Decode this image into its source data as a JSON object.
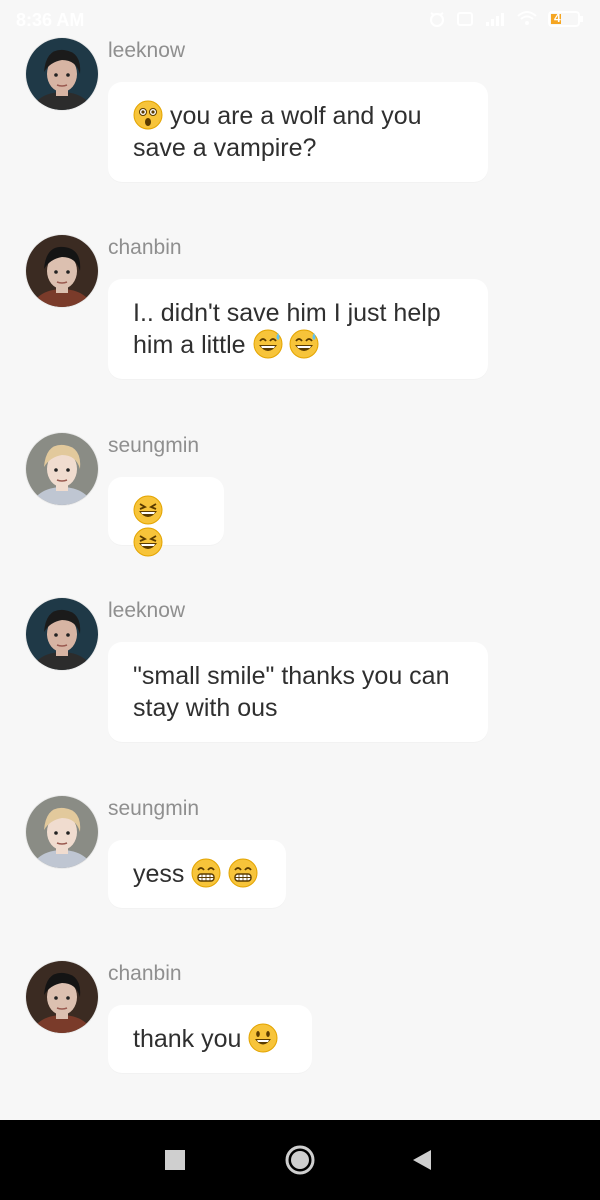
{
  "status_bar": {
    "time": "8:36 AM",
    "battery": "4"
  },
  "messages": [
    {
      "sender": "leeknow",
      "avatar": "leeknow-avatar",
      "emoji_before": [
        "astonished-face"
      ],
      "text": "you are a wolf and you save a vampire?",
      "emoji_after": []
    },
    {
      "sender": "chanbin",
      "avatar": "chanbin-avatar",
      "emoji_before": [],
      "text": "I.. didn't save him I just help him a little",
      "emoji_after": [
        "grinning-sweat-face",
        "grinning-sweat-face"
      ]
    },
    {
      "sender": "seungmin",
      "avatar": "seungmin-avatar",
      "emoji_before": [],
      "text": "",
      "emoji_after": [
        "grinning-squinting-face",
        "grinning-squinting-face"
      ]
    },
    {
      "sender": "leeknow",
      "avatar": "leeknow-avatar",
      "emoji_before": [],
      "text": "\"small smile\" thanks you can stay with ous",
      "emoji_after": []
    },
    {
      "sender": "seungmin",
      "avatar": "seungmin-avatar",
      "emoji_before": [],
      "text": "yess",
      "emoji_after": [
        "beaming-face",
        "beaming-face"
      ]
    },
    {
      "sender": "chanbin",
      "avatar": "chanbin-avatar",
      "emoji_before": [],
      "text": "thank you",
      "emoji_after": [
        "smiley-face"
      ]
    }
  ],
  "nav": {
    "buttons": [
      "recents-button",
      "home-button",
      "back-button"
    ]
  },
  "colors": {
    "background": "#f7f7f7",
    "bubble": "#ffffff",
    "sender_name": "#8f8f8f",
    "message_text": "#2f2f2f",
    "nav_bar": "#000000",
    "emoji_yellow": "#f7c43a"
  }
}
